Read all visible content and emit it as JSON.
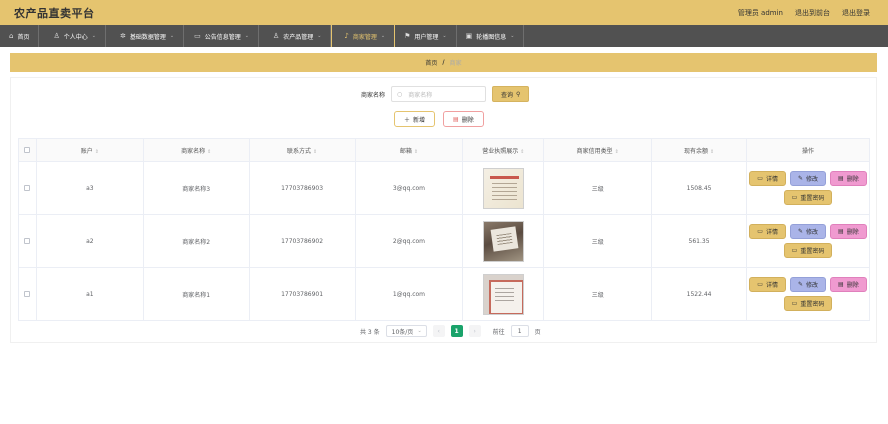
{
  "header": {
    "title": "农产品直卖平台",
    "admin_label": "管理员 admin",
    "back_frontend": "退出到前台",
    "logout": "退出登录"
  },
  "nav": [
    {
      "label": "首页",
      "icon": "home-icon",
      "dropdown": false
    },
    {
      "label": "个人中心",
      "icon": "user-icon",
      "dropdown": true
    },
    {
      "label": "基础数据管理",
      "icon": "gear-icon",
      "dropdown": true
    },
    {
      "label": "公告信息管理",
      "icon": "document-icon",
      "dropdown": true
    },
    {
      "label": "农产品管理",
      "icon": "user-icon",
      "dropdown": true
    },
    {
      "label": "商家管理",
      "icon": "microphone-icon",
      "dropdown": true
    },
    {
      "label": "用户管理",
      "icon": "flag-icon",
      "dropdown": true
    },
    {
      "label": "轮播图信息",
      "icon": "image-icon",
      "dropdown": true
    }
  ],
  "active_nav_index": 5,
  "breadcrumb": {
    "home": "首页",
    "separator": "/",
    "current": "商家"
  },
  "search": {
    "label": "商家名称",
    "placeholder": "商家名称",
    "button": "查询"
  },
  "actions": {
    "add": "新增",
    "delete": "删除"
  },
  "table": {
    "columns": [
      "账户",
      "商家名称",
      "联系方式",
      "邮箱",
      "营业执照展示",
      "商家信用类型",
      "现有余额",
      "操作"
    ],
    "rows": [
      {
        "account": "a3",
        "name": "商家名称3",
        "phone": "17703786903",
        "email": "3@qq.com",
        "credit": "三级",
        "balance": "1508.45"
      },
      {
        "account": "a2",
        "name": "商家名称2",
        "phone": "17703786902",
        "email": "2@qq.com",
        "credit": "三级",
        "balance": "561.35"
      },
      {
        "account": "a1",
        "name": "商家名称1",
        "phone": "17703786901",
        "email": "1@qq.com",
        "credit": "三级",
        "balance": "1522.44"
      }
    ],
    "row_buttons": {
      "detail": "详情",
      "edit": "修改",
      "delete": "删除",
      "reset": "重置密码"
    }
  },
  "pagination": {
    "total": "共 3 条",
    "page_size": "10条/页",
    "current_page": "1",
    "goto_label": "前往",
    "goto_value": "1",
    "page_unit": "页"
  },
  "colors": {
    "accent": "#e5c46f",
    "nav_bg": "#515151",
    "pager_active": "#1aa36b",
    "edit_btn": "#aab4e8",
    "delete_btn": "#f09ad0"
  }
}
